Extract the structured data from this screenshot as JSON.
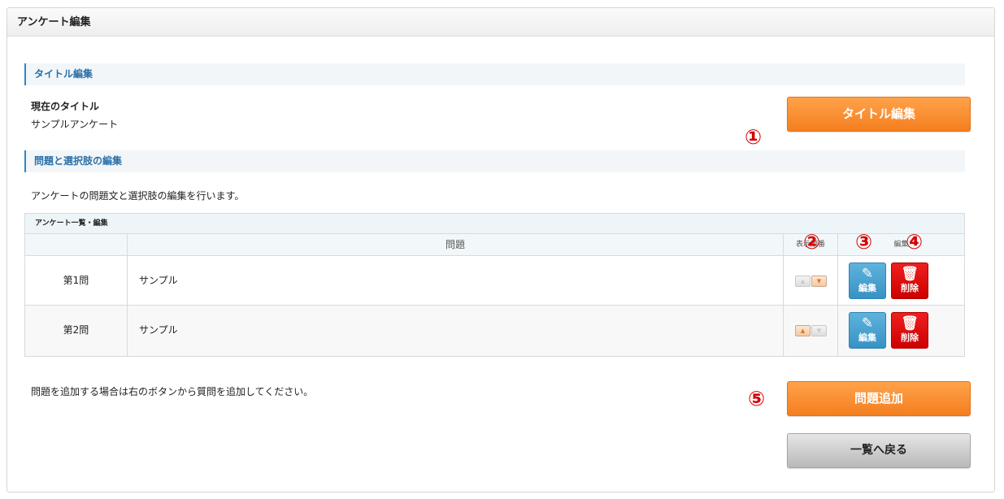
{
  "panel": {
    "title": "アンケート編集"
  },
  "title_section": {
    "heading": "タイトル編集",
    "current_label": "現在のタイトル",
    "current_value": "サンプルアンケート",
    "edit_button": "タイトル編集"
  },
  "question_section": {
    "heading": "問題と選択肢の編集",
    "description": "アンケートの問題文と選択肢の編集を行います。"
  },
  "table": {
    "caption": "アンケート一覧・編集",
    "headers": {
      "question": "問題",
      "order": "表示順番",
      "edit": "編集"
    },
    "rows": [
      {
        "num": "第1問",
        "question": "サンプル",
        "edit_label": "編集",
        "delete_label": "削除"
      },
      {
        "num": "第2問",
        "question": "サンプル",
        "edit_label": "編集",
        "delete_label": "削除"
      }
    ]
  },
  "footer": {
    "add_hint": "問題を追加する場合は右のボタンから質問を追加してください。",
    "add_button": "問題追加",
    "back_button": "一覧へ戻る"
  },
  "annotations": [
    "①",
    "②",
    "③",
    "④",
    "⑤"
  ],
  "colors": {
    "accent_orange": "#f47f1f",
    "edit_blue": "#3792c4",
    "delete_red": "#d40000",
    "annotation_red": "#d40000"
  },
  "icons": {
    "edit": "pencil-icon",
    "delete": "trash-icon",
    "order_up": "triangle-up-icon",
    "order_down": "triangle-down-icon"
  }
}
